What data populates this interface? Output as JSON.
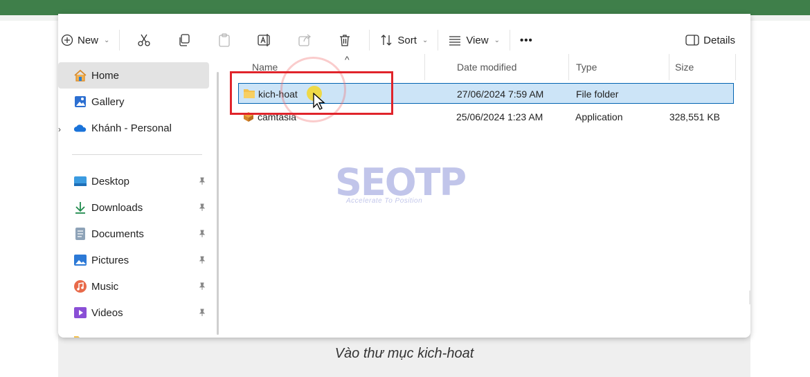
{
  "toolbar": {
    "new_label": "New",
    "sort_label": "Sort",
    "view_label": "View",
    "more_label": "•••",
    "details_label": "Details"
  },
  "sidebar": {
    "items": [
      {
        "label": "Home",
        "icon": "home-icon"
      },
      {
        "label": "Gallery",
        "icon": "gallery-icon"
      },
      {
        "label": "Khánh - Personal",
        "icon": "cloud-icon"
      },
      {
        "label": "Desktop",
        "icon": "desktop-icon"
      },
      {
        "label": "Downloads",
        "icon": "download-icon"
      },
      {
        "label": "Documents",
        "icon": "documents-icon"
      },
      {
        "label": "Pictures",
        "icon": "pictures-icon"
      },
      {
        "label": "Music",
        "icon": "music-icon"
      },
      {
        "label": "Videos",
        "icon": "videos-icon"
      }
    ]
  },
  "columns": {
    "name": "Name",
    "date": "Date modified",
    "type": "Type",
    "size": "Size"
  },
  "files": [
    {
      "name": "kich-hoat",
      "date": "27/06/2024 7:59 AM",
      "type": "File folder",
      "size": ""
    },
    {
      "name": "camtasia",
      "date": "25/06/2024 1:23 AM",
      "type": "Application",
      "size": "328,551 KB"
    }
  ],
  "watermark": {
    "brand": "SEOTP",
    "tagline": "Accelerate To Position"
  },
  "caption": "Vào thư mục kich-hoat",
  "colors": {
    "accent_bar": "#3f7f4a",
    "selection": "#cce4f7",
    "highlight": "#e0242b"
  }
}
